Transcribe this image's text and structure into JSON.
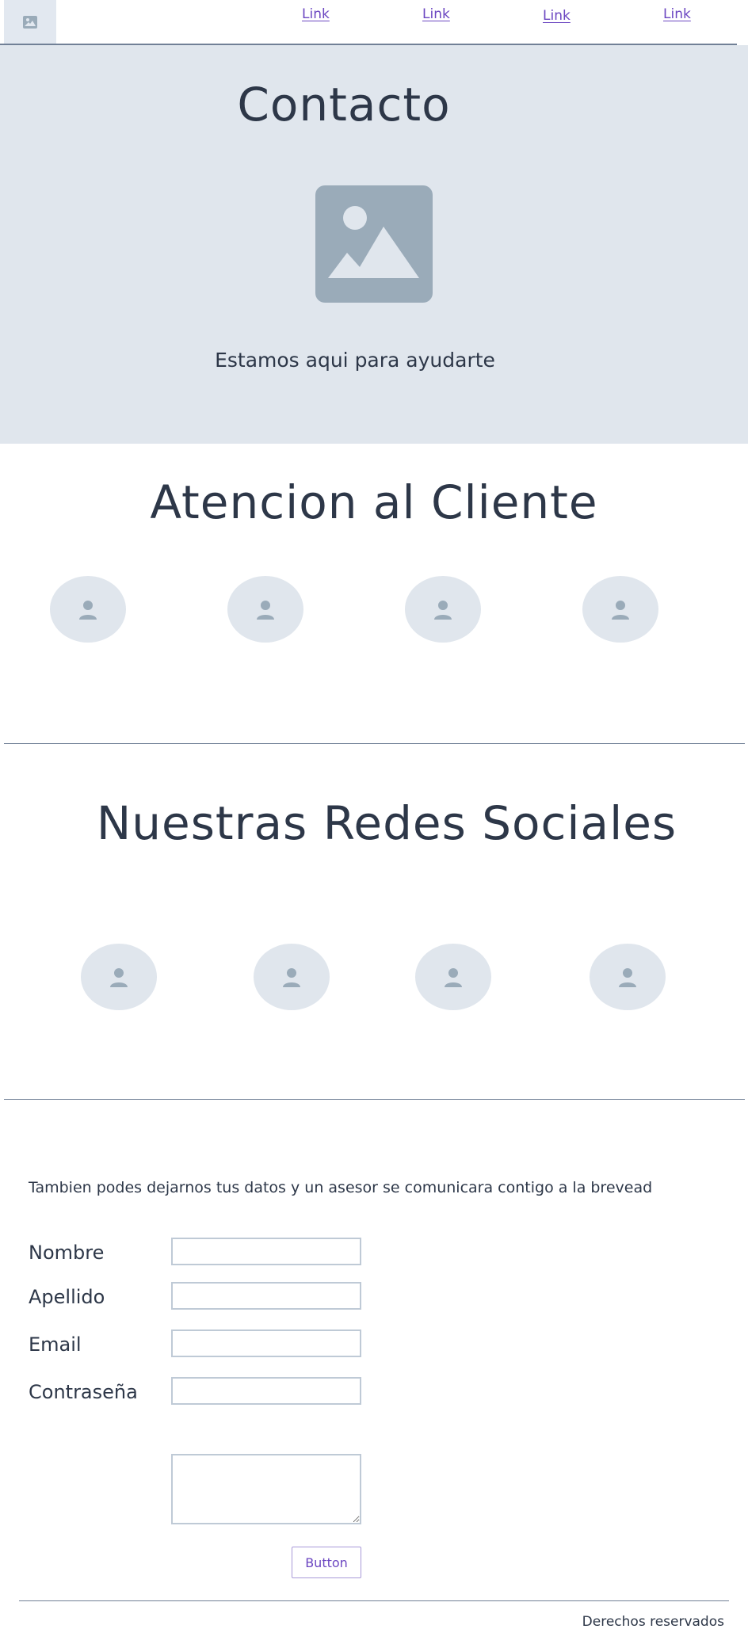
{
  "nav": {
    "logo_icon": "image-icon",
    "links": [
      "Link",
      "Link",
      "Link",
      "Link"
    ]
  },
  "hero": {
    "title": "Contacto",
    "image_icon": "image-icon",
    "tagline": "Estamos aqui para ayudarte"
  },
  "customer_service": {
    "title": "Atencion al Cliente",
    "avatar_icon": "user-icon"
  },
  "social": {
    "title": "Nuestras Redes Sociales",
    "avatar_icon": "user-icon"
  },
  "form": {
    "intro": "Tambien podes dejarnos tus datos y un asesor se comunicara contigo a la brevead",
    "fields": [
      {
        "label": "Nombre",
        "value": ""
      },
      {
        "label": "Apellido",
        "value": ""
      },
      {
        "label": "Email",
        "value": ""
      },
      {
        "label": "Contraseña",
        "value": ""
      }
    ],
    "message_value": "",
    "submit_label": "Button"
  },
  "footer": {
    "text": "Derechos reservados"
  },
  "colors": {
    "hero_bg": "#e0e6ed",
    "placeholder_gray": "#9aabb9",
    "link": "#6b46c1",
    "text": "#2d3748",
    "rule": "#718096"
  }
}
